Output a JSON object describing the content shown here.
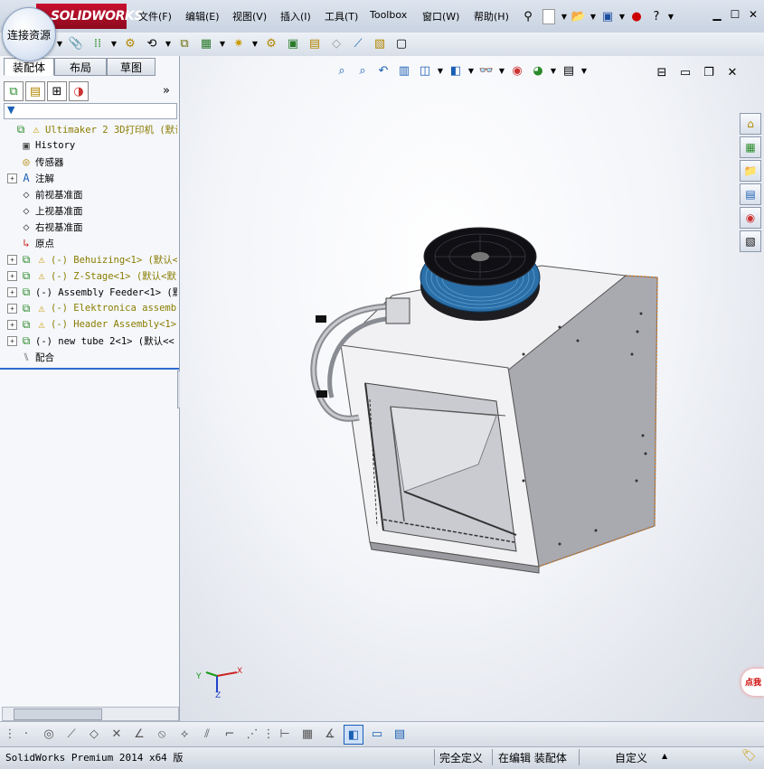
{
  "app": {
    "logo_text": "SOLIDWORKS",
    "connect_label": "连接资源"
  },
  "menu": [
    "文件(F)",
    "编辑(E)",
    "视图(V)",
    "插入(I)",
    "工具(T)",
    "Toolbox",
    "窗口(W)",
    "帮助(H)"
  ],
  "panel": {
    "tabs": [
      "装配体",
      "布局",
      "草图"
    ],
    "tree": [
      {
        "label": "Ultimaker 2 3D打印机 (默认",
        "icon": "assembly-icon",
        "warn": true,
        "expand": false,
        "indent": 0,
        "olive": true
      },
      {
        "label": "History",
        "icon": "history-icon",
        "warn": false,
        "expand": false,
        "indent": 1,
        "olive": false
      },
      {
        "label": "传感器",
        "icon": "sensor-icon",
        "warn": false,
        "expand": false,
        "indent": 1,
        "olive": false
      },
      {
        "label": "注解",
        "icon": "annotation-icon",
        "warn": false,
        "expand": true,
        "indent": 1,
        "olive": false
      },
      {
        "label": "前视基准面",
        "icon": "plane-icon",
        "warn": false,
        "expand": false,
        "indent": 1,
        "olive": false
      },
      {
        "label": "上视基准面",
        "icon": "plane-icon",
        "warn": false,
        "expand": false,
        "indent": 1,
        "olive": false
      },
      {
        "label": "右视基准面",
        "icon": "plane-icon",
        "warn": false,
        "expand": false,
        "indent": 1,
        "olive": false
      },
      {
        "label": "原点",
        "icon": "origin-icon",
        "warn": false,
        "expand": false,
        "indent": 1,
        "olive": false
      },
      {
        "label": "(-) Behuizing<1> (默认<",
        "icon": "assembly-icon",
        "warn": true,
        "expand": true,
        "indent": 1,
        "olive": true
      },
      {
        "label": "(-) Z-Stage<1> (默认<默",
        "icon": "assembly-icon",
        "warn": true,
        "expand": true,
        "indent": 1,
        "olive": true
      },
      {
        "label": "(-) Assembly Feeder<1> (默",
        "icon": "assembly-icon",
        "warn": false,
        "expand": true,
        "indent": 1,
        "olive": false
      },
      {
        "label": "(-) Elektronica assembl",
        "icon": "assembly-icon",
        "warn": true,
        "expand": true,
        "indent": 1,
        "olive": true
      },
      {
        "label": "(-) Header Assembly<1>",
        "icon": "assembly-icon",
        "warn": true,
        "expand": true,
        "indent": 1,
        "olive": true
      },
      {
        "label": "(-) new tube 2<1> (默认<<",
        "icon": "assembly-icon",
        "warn": false,
        "expand": true,
        "indent": 1,
        "olive": false
      },
      {
        "label": "配合",
        "icon": "mates-icon",
        "warn": false,
        "expand": false,
        "indent": 1,
        "olive": false
      }
    ]
  },
  "triad": {
    "x": "X",
    "y": "Y",
    "z": "Z"
  },
  "status": {
    "product": "SolidWorks Premium 2014 x64 版",
    "defined": "完全定义",
    "mode": "在编辑 装配体",
    "units": "自定义"
  },
  "side_popup": "点我"
}
